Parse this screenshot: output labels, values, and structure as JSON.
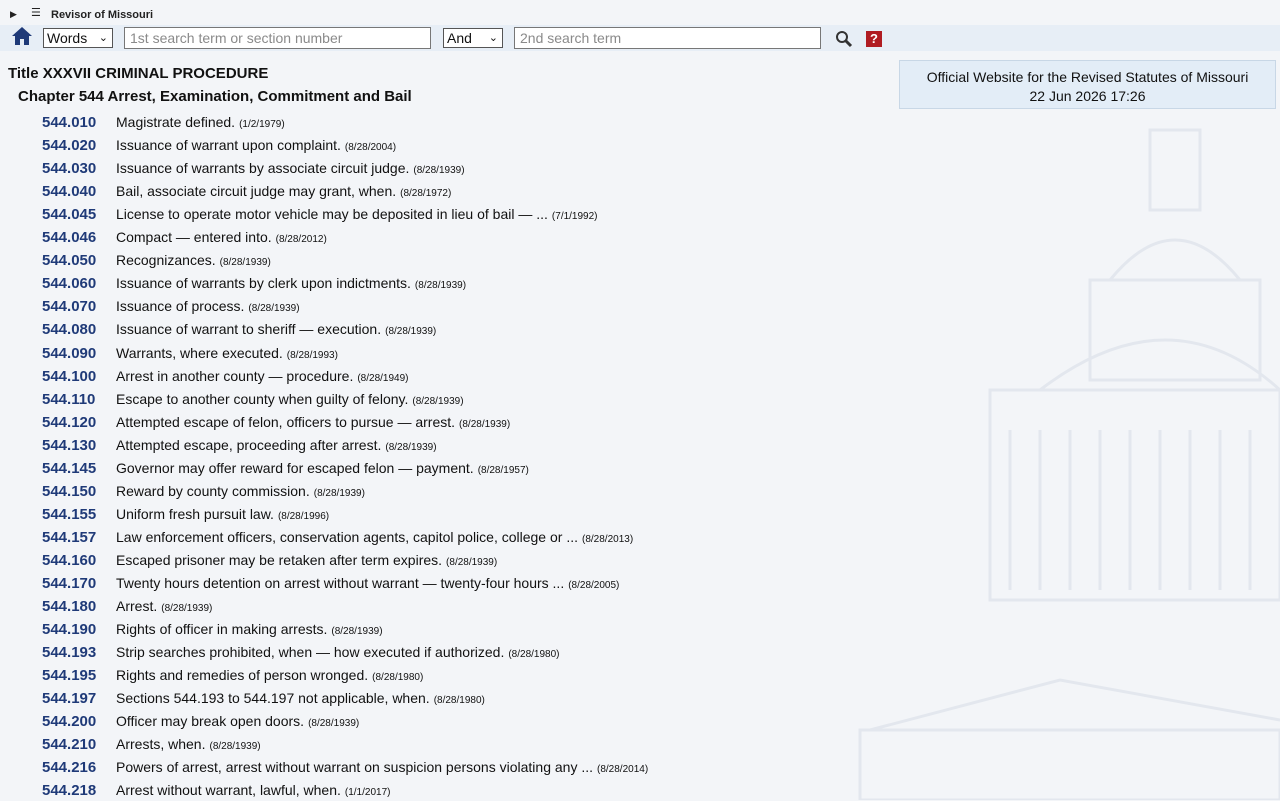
{
  "topbar": {
    "brand": "Revisor of Missouri"
  },
  "search": {
    "mode_selected": "Words",
    "term1_placeholder": "1st search term or section number",
    "operator_selected": "And",
    "term2_placeholder": "2nd search term"
  },
  "info": {
    "line1": "Official Website for the Revised Statutes of Missouri",
    "line2": "22 Jun 2026 17:26"
  },
  "heading": {
    "title": "Title XXXVII CRIMINAL PROCEDURE",
    "chapter": "Chapter 544 Arrest, Examination, Commitment and Bail"
  },
  "sections": [
    {
      "num": "544.010",
      "desc": "Magistrate defined.",
      "date": "(1/2/1979)"
    },
    {
      "num": "544.020",
      "desc": "Issuance of warrant upon complaint.",
      "date": "(8/28/2004)"
    },
    {
      "num": "544.030",
      "desc": "Issuance of warrants by associate circuit judge.",
      "date": "(8/28/1939)"
    },
    {
      "num": "544.040",
      "desc": "Bail, associate circuit judge may grant, when.",
      "date": "(8/28/1972)"
    },
    {
      "num": "544.045",
      "desc": "License to operate motor vehicle may be deposited in lieu of bail — ...",
      "date": "(7/1/1992)"
    },
    {
      "num": "544.046",
      "desc": "Compact — entered into.",
      "date": "(8/28/2012)"
    },
    {
      "num": "544.050",
      "desc": "Recognizances.",
      "date": "(8/28/1939)"
    },
    {
      "num": "544.060",
      "desc": "Issuance of warrants by clerk upon indictments.",
      "date": "(8/28/1939)"
    },
    {
      "num": "544.070",
      "desc": "Issuance of process.",
      "date": "(8/28/1939)"
    },
    {
      "num": "544.080",
      "desc": "Issuance of warrant to sheriff — execution.",
      "date": "(8/28/1939)"
    },
    {
      "num": "544.090",
      "desc": "Warrants, where executed.",
      "date": "(8/28/1993)"
    },
    {
      "num": "544.100",
      "desc": "Arrest in another county — procedure.",
      "date": "(8/28/1949)"
    },
    {
      "num": "544.110",
      "desc": "Escape to another county when guilty of felony.",
      "date": "(8/28/1939)"
    },
    {
      "num": "544.120",
      "desc": "Attempted escape of felon, officers to pursue — arrest.",
      "date": "(8/28/1939)"
    },
    {
      "num": "544.130",
      "desc": "Attempted escape, proceeding after arrest.",
      "date": "(8/28/1939)"
    },
    {
      "num": "544.145",
      "desc": "Governor may offer reward for escaped felon — payment.",
      "date": "(8/28/1957)"
    },
    {
      "num": "544.150",
      "desc": "Reward by county commission.",
      "date": "(8/28/1939)"
    },
    {
      "num": "544.155",
      "desc": "Uniform fresh pursuit law.",
      "date": "(8/28/1996)"
    },
    {
      "num": "544.157",
      "desc": "Law enforcement officers, conservation agents, capitol police, college or ...",
      "date": "(8/28/2013)"
    },
    {
      "num": "544.160",
      "desc": "Escaped prisoner may be retaken after term expires.",
      "date": "(8/28/1939)"
    },
    {
      "num": "544.170",
      "desc": "Twenty hours detention on arrest without warrant — twenty-four hours ...",
      "date": "(8/28/2005)"
    },
    {
      "num": "544.180",
      "desc": "Arrest.",
      "date": "(8/28/1939)"
    },
    {
      "num": "544.190",
      "desc": "Rights of officer in making arrests.",
      "date": "(8/28/1939)"
    },
    {
      "num": "544.193",
      "desc": "Strip searches prohibited, when — how executed if authorized.",
      "date": "(8/28/1980)"
    },
    {
      "num": "544.195",
      "desc": "Rights and remedies of person wronged.",
      "date": "(8/28/1980)"
    },
    {
      "num": "544.197",
      "desc": "Sections 544.193 to 544.197 not applicable, when.",
      "date": "(8/28/1980)"
    },
    {
      "num": "544.200",
      "desc": "Officer may break open doors.",
      "date": "(8/28/1939)"
    },
    {
      "num": "544.210",
      "desc": "Arrests, when.",
      "date": "(8/28/1939)"
    },
    {
      "num": "544.216",
      "desc": "Powers of arrest, arrest without warrant on suspicion persons violating any ...",
      "date": "(8/28/2014)"
    },
    {
      "num": "544.218",
      "desc": "Arrest without warrant, lawful, when.",
      "date": "(1/1/2017)"
    }
  ]
}
